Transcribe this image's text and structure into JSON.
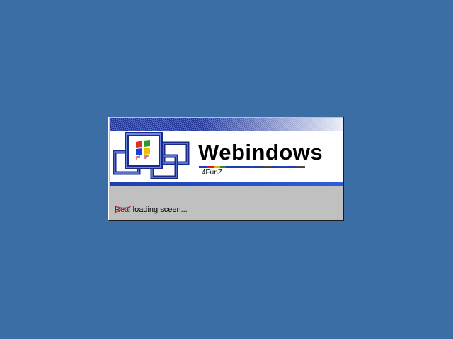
{
  "desktop": {
    "background_color": "#3a6ea5"
  },
  "splash": {
    "title": "Webindows",
    "subtitle": "4FunZ",
    "status_struck_word": "Real",
    "status_text": " loading sceen...",
    "logo_icon": "windows-flag-icon",
    "accent_color": "#1c3fb0",
    "strike_color": "#cc2222"
  }
}
